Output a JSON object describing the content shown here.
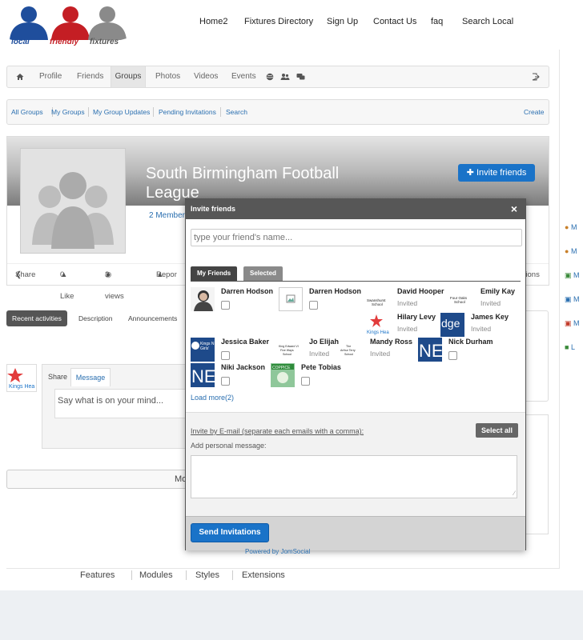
{
  "header": {
    "logo": {
      "words": [
        "local",
        "friendly",
        "fixtures"
      ],
      "colors": [
        "#1f4e9c",
        "#c41e24",
        "#777777"
      ]
    },
    "nav": [
      "Home2",
      "Fixtures Directory",
      "Sign Up",
      "Contact Us",
      "faq",
      "Search Local"
    ]
  },
  "toolbar": {
    "home_icon": "home-icon",
    "items": [
      "Profile",
      "Friends",
      "Groups",
      "Photos",
      "Videos",
      "Events"
    ],
    "active": "Groups",
    "extra_icons": [
      "globe-icon",
      "users-icon",
      "chat-icon"
    ],
    "logout_icon": "logout-icon"
  },
  "subnav": {
    "links": [
      "All Groups",
      "My Groups",
      "My Group Updates",
      "Pending Invitations",
      "Search"
    ],
    "create": "Create"
  },
  "group": {
    "title_line1": "South Birmingham Football",
    "title_line2": "League",
    "members": "2 Member",
    "invite_button": "Invite friends",
    "stats": {
      "share": "Share",
      "like": "0 Like",
      "views": "3 views",
      "report": "Repor",
      "right": "ctions"
    }
  },
  "tabs": [
    "Recent activities",
    "Description",
    "Announcements"
  ],
  "share": {
    "tabs": [
      "Share",
      "Message"
    ],
    "placeholder": "Say what is on your mind...",
    "more_button_fragment": "Mo"
  },
  "sidebar_letters": [
    "M",
    "M",
    "M",
    "M",
    "M",
    "L"
  ],
  "modal": {
    "title": "Invite friends",
    "close": "×",
    "search_placeholder": "type your friend's name...",
    "tabs": [
      "My Friends",
      "Selected"
    ],
    "friends": [
      {
        "name": "Darren Hodson",
        "status": "",
        "thumb": "photo"
      },
      {
        "name": "Darren Hodson",
        "status": "",
        "thumb": "broken"
      },
      {
        "name": "David Hooper",
        "status": "Invited",
        "thumb": "Swanshurst School"
      },
      {
        "name": "Emily Kay",
        "status": "Invited",
        "thumb": "Four Oaks School"
      },
      {
        "name": "Hilary Levy",
        "status": "Invited",
        "thumb": "Kings Hea"
      },
      {
        "name": "James Key",
        "status": "Invited",
        "thumb": "dge"
      },
      {
        "name": "Jessica Baker",
        "status": "",
        "thumb": "Kings Norton Girls"
      },
      {
        "name": "Jo Elijah",
        "status": "Invited",
        "thumb": "King Edward VI Five Ways School"
      },
      {
        "name": "Mandy Ross",
        "status": "Invited",
        "thumb": "The Arthur Terry School"
      },
      {
        "name": "Nick Durham",
        "status": "",
        "thumb": "NE"
      },
      {
        "name": "Niki Jackson",
        "status": "",
        "thumb": "NE"
      },
      {
        "name": "Pete Tobias",
        "status": "",
        "thumb": "COPPICE"
      }
    ],
    "load_more": "Load more(2)",
    "invite_email": "Invite by E-mail (separate each emails with a comma):",
    "select_all": "Select all",
    "add_message": "Add personal message:",
    "send": "Send Invitations"
  },
  "powered_by": "Powered by JomSocial",
  "footer": [
    "Features",
    "Modules",
    "Styles",
    "Extensions"
  ],
  "accent": "#1a73c8"
}
